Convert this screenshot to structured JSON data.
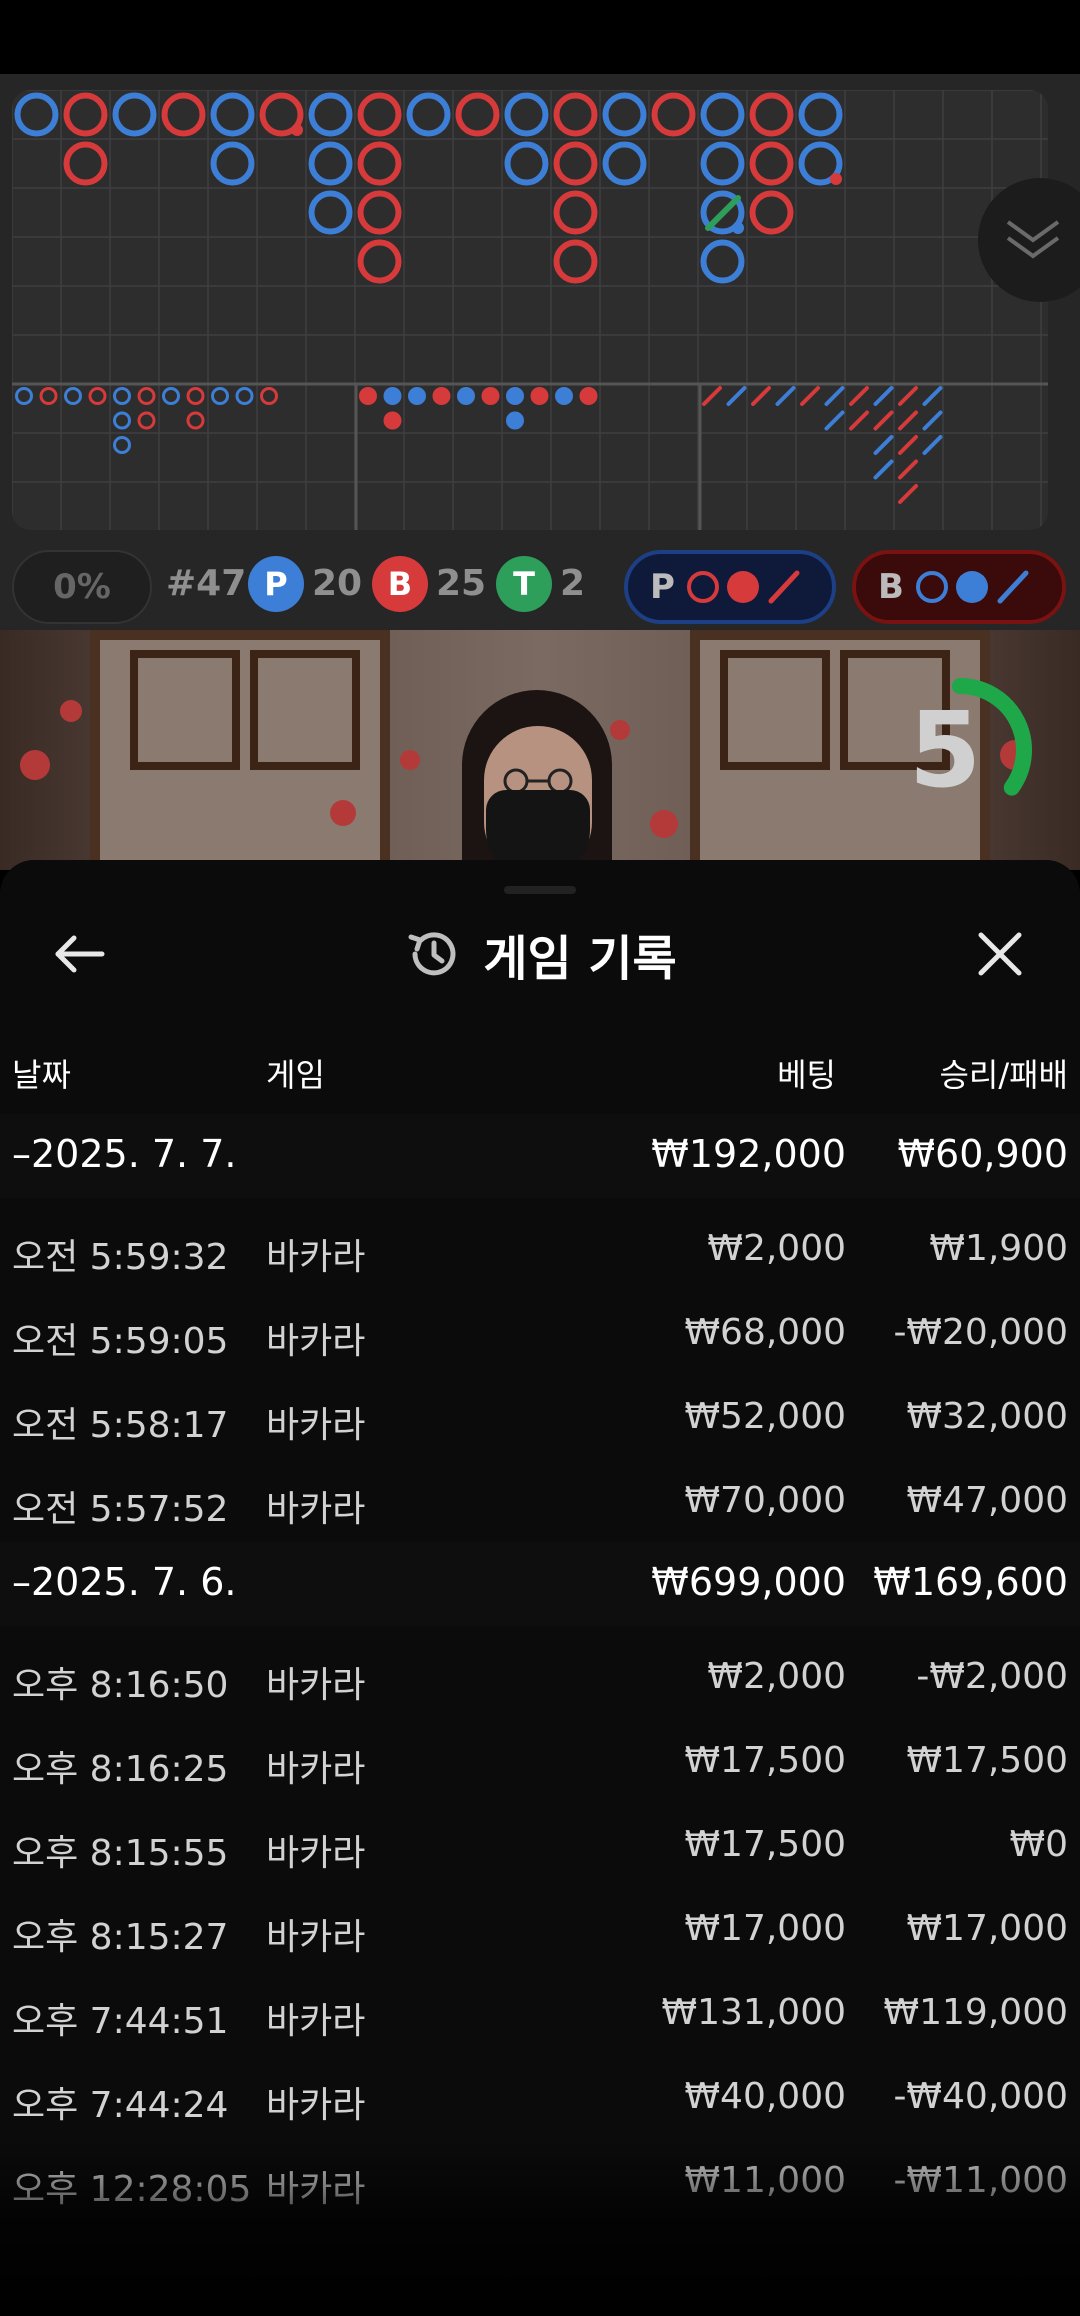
{
  "scoreboard": {
    "colors": {
      "player": "#3d7fd6",
      "banker": "#d63a3a",
      "tie": "#2e9e5b",
      "panel": "#2d2d2e",
      "grid": "#3f3f40"
    },
    "bead_road": {
      "columns": [
        [
          "P"
        ],
        [
          "B",
          "B"
        ],
        [
          "P"
        ],
        [
          "B"
        ],
        [
          "P",
          "P"
        ],
        [
          "B"
        ],
        [
          "P",
          "P",
          "P"
        ],
        [
          "B",
          "B",
          "B",
          "B"
        ],
        [
          "P"
        ],
        [
          "B"
        ],
        [
          "P",
          "P"
        ],
        [
          "B",
          "B",
          "B",
          "B"
        ],
        [
          "P",
          "P"
        ],
        [
          "B"
        ],
        [
          "P",
          "P",
          "P",
          "P"
        ],
        [
          "B",
          "B",
          "B"
        ],
        [
          "P",
          "P"
        ]
      ],
      "tie_marks": [
        {
          "col": 14,
          "row": 2,
          "color": "tie"
        }
      ],
      "pair_dots": [
        {
          "col": 5,
          "row": 0,
          "color": "banker"
        },
        {
          "col": 16,
          "row": 1,
          "color": "banker"
        },
        {
          "col": 14,
          "row": 2,
          "color": "player"
        }
      ],
      "partial_rings": [
        {
          "col": 5,
          "row": 0,
          "color": "banker"
        },
        {
          "col": 16,
          "row": 1,
          "color": "player"
        }
      ]
    },
    "small_road_rings": [
      {
        "col": 0,
        "row": 0,
        "c": "P"
      },
      {
        "col": 1,
        "row": 0,
        "c": "B"
      },
      {
        "col": 2,
        "row": 0,
        "c": "P"
      },
      {
        "col": 3,
        "row": 0,
        "c": "B"
      },
      {
        "col": 4,
        "row": 0,
        "c": "P"
      },
      {
        "col": 4,
        "row": 1,
        "c": "P"
      },
      {
        "col": 4,
        "row": 2,
        "c": "P"
      },
      {
        "col": 5,
        "row": 0,
        "c": "B"
      },
      {
        "col": 5,
        "row": 1,
        "c": "B"
      },
      {
        "col": 6,
        "row": 0,
        "c": "P"
      },
      {
        "col": 7,
        "row": 0,
        "c": "B"
      },
      {
        "col": 7,
        "row": 1,
        "c": "B"
      },
      {
        "col": 8,
        "row": 0,
        "c": "P"
      },
      {
        "col": 9,
        "row": 0,
        "c": "P"
      },
      {
        "col": 10,
        "row": 0,
        "c": "B"
      }
    ],
    "dot_road": [
      {
        "col": 0,
        "row": 0,
        "c": "B"
      },
      {
        "col": 1,
        "row": 0,
        "c": "P"
      },
      {
        "col": 1,
        "row": 1,
        "c": "B"
      },
      {
        "col": 2,
        "row": 0,
        "c": "P"
      },
      {
        "col": 3,
        "row": 0,
        "c": "B"
      },
      {
        "col": 4,
        "row": 0,
        "c": "P"
      },
      {
        "col": 5,
        "row": 0,
        "c": "B"
      },
      {
        "col": 6,
        "row": 0,
        "c": "P"
      },
      {
        "col": 6,
        "row": 1,
        "c": "P"
      },
      {
        "col": 7,
        "row": 0,
        "c": "B"
      },
      {
        "col": 8,
        "row": 0,
        "c": "P"
      },
      {
        "col": 9,
        "row": 0,
        "c": "B"
      }
    ],
    "slash_road": [
      {
        "col": 0,
        "row": 0,
        "c": "B"
      },
      {
        "col": 1,
        "row": 0,
        "c": "P"
      },
      {
        "col": 2,
        "row": 0,
        "c": "B"
      },
      {
        "col": 3,
        "row": 0,
        "c": "P"
      },
      {
        "col": 4,
        "row": 0,
        "c": "B"
      },
      {
        "col": 5,
        "row": 0,
        "c": "P"
      },
      {
        "col": 5,
        "row": 1,
        "c": "P"
      },
      {
        "col": 6,
        "row": 0,
        "c": "B"
      },
      {
        "col": 6,
        "row": 1,
        "c": "B"
      },
      {
        "col": 7,
        "row": 0,
        "c": "P"
      },
      {
        "col": 7,
        "row": 1,
        "c": "B"
      },
      {
        "col": 7,
        "row": 2,
        "c": "P"
      },
      {
        "col": 7,
        "row": 3,
        "c": "P"
      },
      {
        "col": 8,
        "row": 0,
        "c": "B"
      },
      {
        "col": 8,
        "row": 1,
        "c": "B"
      },
      {
        "col": 8,
        "row": 2,
        "c": "B"
      },
      {
        "col": 8,
        "row": 3,
        "c": "B"
      },
      {
        "col": 8,
        "row": 4,
        "c": "B"
      },
      {
        "col": 9,
        "row": 0,
        "c": "P"
      },
      {
        "col": 9,
        "row": 1,
        "c": "P"
      },
      {
        "col": 9,
        "row": 2,
        "c": "P"
      }
    ],
    "percentage": "0%",
    "round": "#47",
    "player_label": "P",
    "player_count": "20",
    "banker_label": "B",
    "banker_count": "25",
    "tie_label": "T",
    "tie_count": "2",
    "predict_player_label": "P",
    "predict_banker_label": "B"
  },
  "video": {
    "countdown": "5",
    "countdown_fraction": 0.35
  },
  "history": {
    "title": "게임 기록",
    "columns": {
      "date": "날짜",
      "game": "게임",
      "bet": "베팅",
      "win_loss": "승리/패배"
    },
    "groups": [
      {
        "date": "–2025. 7. 7.",
        "bet_total": "₩192,000",
        "win_total": "₩60,900",
        "rows": [
          {
            "time": "오전 5:59:32",
            "game": "바카라",
            "bet": "₩2,000",
            "win": "₩1,900"
          },
          {
            "time": "오전 5:59:05",
            "game": "바카라",
            "bet": "₩68,000",
            "win": "-₩20,000"
          },
          {
            "time": "오전 5:58:17",
            "game": "바카라",
            "bet": "₩52,000",
            "win": "₩32,000"
          },
          {
            "time": "오전 5:57:52",
            "game": "바카라",
            "bet": "₩70,000",
            "win": "₩47,000"
          }
        ]
      },
      {
        "date": "–2025. 7. 6.",
        "bet_total": "₩699,000",
        "win_total": "₩169,600",
        "rows": [
          {
            "time": "오후 8:16:50",
            "game": "바카라",
            "bet": "₩2,000",
            "win": "-₩2,000"
          },
          {
            "time": "오후 8:16:25",
            "game": "바카라",
            "bet": "₩17,500",
            "win": "₩17,500"
          },
          {
            "time": "오후 8:15:55",
            "game": "바카라",
            "bet": "₩17,500",
            "win": "₩0"
          },
          {
            "time": "오후 8:15:27",
            "game": "바카라",
            "bet": "₩17,000",
            "win": "₩17,000"
          },
          {
            "time": "오후 7:44:51",
            "game": "바카라",
            "bet": "₩131,000",
            "win": "₩119,000"
          },
          {
            "time": "오후 7:44:24",
            "game": "바카라",
            "bet": "₩40,000",
            "win": "-₩40,000"
          },
          {
            "time": "오후 12:28:05",
            "game": "바카라",
            "bet": "₩11,000",
            "win": "-₩11,000"
          }
        ]
      }
    ]
  }
}
